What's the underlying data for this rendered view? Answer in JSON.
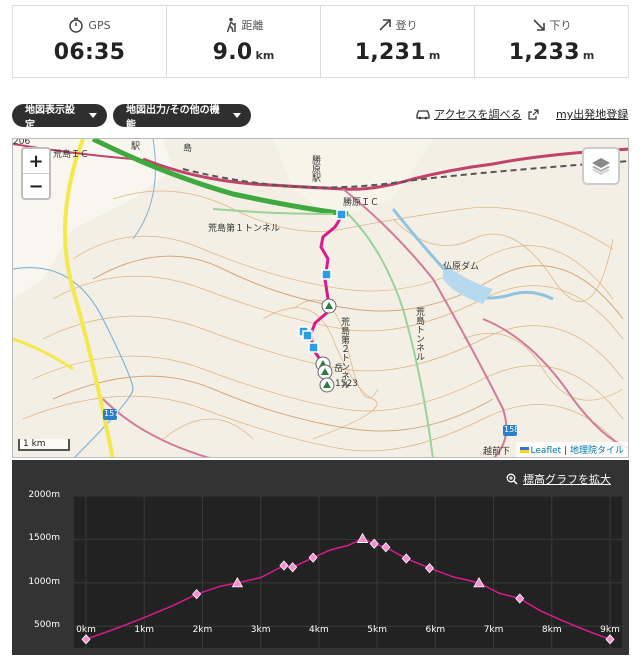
{
  "stats": [
    {
      "label": "GPS",
      "value": "06:35",
      "unit": "",
      "icon": "stopwatch-icon"
    },
    {
      "label": "距離",
      "value": "9.0",
      "unit": "km",
      "icon": "hiker-icon"
    },
    {
      "label": "登り",
      "value": "1,231",
      "unit": "m",
      "icon": "arrow-up-right-icon"
    },
    {
      "label": "下り",
      "value": "1,233",
      "unit": "m",
      "icon": "arrow-down-right-icon"
    }
  ],
  "toolbar": {
    "map_display_settings": "地図表示設定",
    "map_output_other": "地図出力/その他の機能",
    "access_link": "アクセスを調べる",
    "my_departure_link": "my出発地登録"
  },
  "map": {
    "zoom_in": "+",
    "zoom_out": "−",
    "scale": "1 km",
    "attribution_leaflet": "Leaflet",
    "attribution_sep": "|",
    "attribution_gsi": "地理院タイル",
    "labels": {
      "ic_left": "荒島ＩＣ",
      "station": "勝原駅",
      "ic_right": "勝原ＩＣ",
      "tunnel1": "荒島第１トンネル",
      "dam": "仏原ダム",
      "tunnel2": "荒島第２トンネル",
      "tunnel_v": "荒島トンネル",
      "route157": "157",
      "route158": "158",
      "peak": "1523",
      "peak_char": "岳",
      "road206": "206",
      "kanji_top": "駅",
      "kanji_top2": "島",
      "katsu_bottom": "越前下"
    }
  },
  "elevation": {
    "expand_label": "標高グラフを拡大",
    "y_ticks": [
      "2000m",
      "1500m",
      "1000m",
      "500m"
    ],
    "x_ticks": [
      "0km",
      "1km",
      "2km",
      "3km",
      "4km",
      "5km",
      "6km",
      "7km",
      "8km",
      "9km"
    ]
  },
  "chart_data": {
    "type": "line",
    "title": "",
    "xlabel": "",
    "ylabel": "",
    "xlim": [
      0,
      9
    ],
    "ylim": [
      250,
      2000
    ],
    "x": [
      0,
      0.5,
      1,
      1.5,
      1.9,
      2.3,
      2.6,
      3.0,
      3.4,
      3.55,
      3.9,
      4.2,
      4.5,
      4.75,
      4.95,
      5.15,
      5.5,
      5.9,
      6.3,
      6.75,
      7.1,
      7.45,
      7.8,
      8.2,
      8.6,
      9.0
    ],
    "y": [
      350,
      470,
      600,
      740,
      870,
      960,
      1000,
      1060,
      1200,
      1180,
      1290,
      1380,
      1430,
      1510,
      1450,
      1410,
      1280,
      1170,
      1070,
      1000,
      880,
      820,
      680,
      560,
      450,
      350
    ],
    "markers": [
      {
        "x": 0,
        "y": 350,
        "shape": "diamond"
      },
      {
        "x": 1.9,
        "y": 870,
        "shape": "diamond"
      },
      {
        "x": 2.6,
        "y": 1000,
        "shape": "triangle"
      },
      {
        "x": 3.4,
        "y": 1200,
        "shape": "diamond"
      },
      {
        "x": 3.55,
        "y": 1180,
        "shape": "diamond"
      },
      {
        "x": 3.9,
        "y": 1290,
        "shape": "diamond"
      },
      {
        "x": 4.75,
        "y": 1510,
        "shape": "triangle"
      },
      {
        "x": 4.95,
        "y": 1450,
        "shape": "diamond"
      },
      {
        "x": 5.15,
        "y": 1410,
        "shape": "diamond"
      },
      {
        "x": 5.5,
        "y": 1280,
        "shape": "diamond"
      },
      {
        "x": 5.9,
        "y": 1170,
        "shape": "diamond"
      },
      {
        "x": 6.75,
        "y": 1000,
        "shape": "triangle"
      },
      {
        "x": 7.45,
        "y": 820,
        "shape": "diamond"
      },
      {
        "x": 9.0,
        "y": 350,
        "shape": "diamond"
      }
    ],
    "grid": true,
    "colors": {
      "line": "#d81b8c",
      "marker_fill": "#f48fd0",
      "plot_bg": "#222222",
      "panel_bg": "#333333"
    }
  }
}
